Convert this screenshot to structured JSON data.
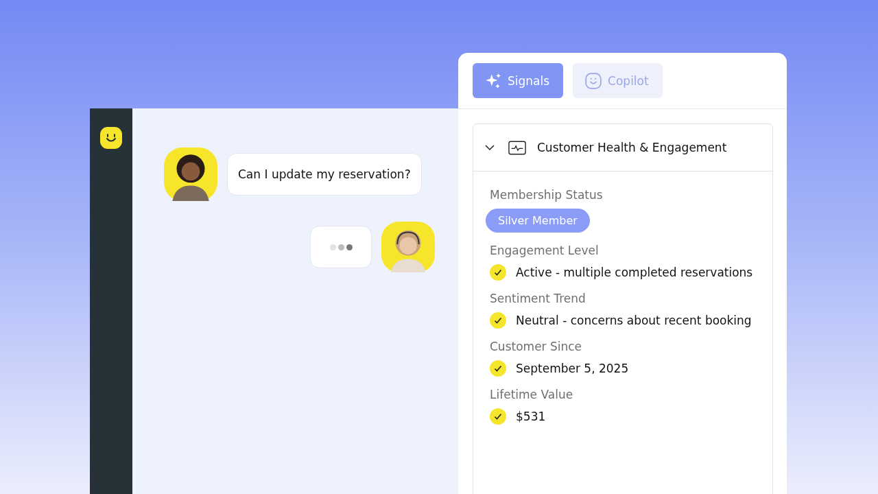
{
  "chat": {
    "messages": [
      {
        "kind": "customer",
        "text": "Can I update my reservation?"
      },
      {
        "kind": "typing"
      }
    ]
  },
  "panel": {
    "tabs": [
      {
        "label": "Signals",
        "selected": true
      },
      {
        "label": "Copilot",
        "selected": false
      }
    ],
    "card": {
      "title": "Customer Health & Engagement",
      "expanded": true,
      "fields": [
        {
          "label": "Membership Status",
          "kind": "badge",
          "value": "Silver Member"
        },
        {
          "label": "Engagement Level",
          "kind": "check",
          "checked": true,
          "value": "Active - multiple completed reservations"
        },
        {
          "label": "Sentiment Trend",
          "kind": "check",
          "checked": true,
          "value": "Neutral - concerns about recent booking"
        },
        {
          "label": "Customer Since",
          "kind": "check",
          "checked": true,
          "value": "September 5, 2025"
        },
        {
          "label": "Lifetime Value",
          "kind": "check",
          "checked": true,
          "value": "$531"
        }
      ]
    }
  }
}
